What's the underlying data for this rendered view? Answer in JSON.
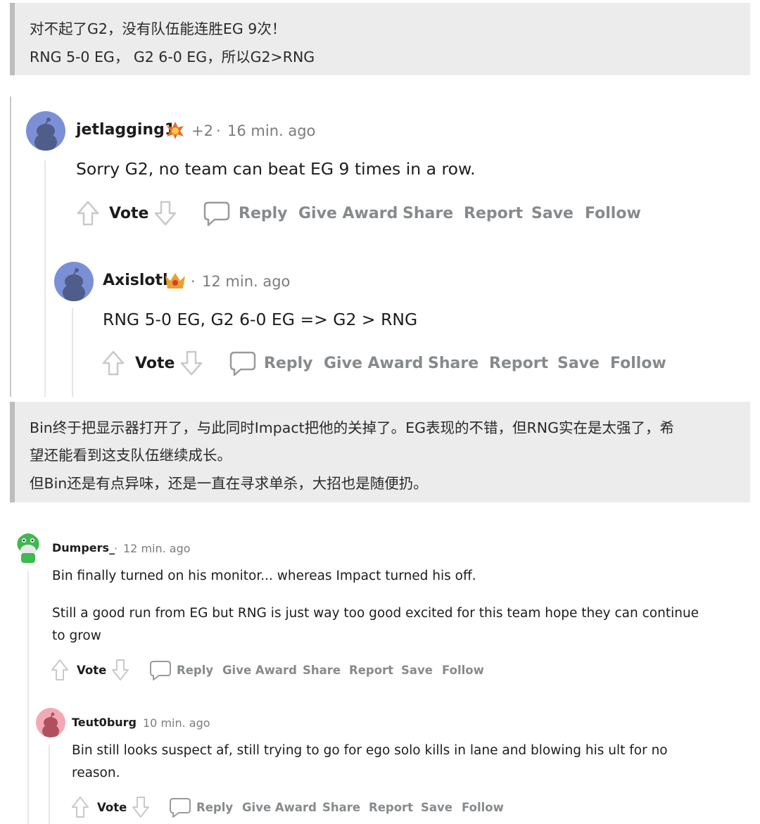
{
  "caption1": {
    "line1": "对不起了G2，没有队伍能连胜EG 9次！",
    "line2": "RNG 5-0 EG， G2 6-0 EG，所以G2>RNG"
  },
  "caption2": {
    "line1": "Bin终于把显示器打开了，与此同时Impact把他的关掉了。EG表现的不错，但RNG实在是太强了，希",
    "line2": "望还能看到这支队伍继续成长。",
    "line3": "但Bin还是有点异味，还是一直在寻求单杀，大招也是随便扔。"
  },
  "comments": [
    {
      "username": "jetlagging1",
      "score": "+2",
      "time": "16 min. ago",
      "body": "Sorry G2, no team can beat EG 9 times in a row.",
      "avatar_color": "#7b8fd6",
      "flair_icon": "award-icon"
    },
    {
      "username": "Axislotl",
      "time": "12 min. ago",
      "body": "RNG 5-0 EG, G2 6-0 EG => G2 > RNG",
      "avatar_color": "#7b8fd6",
      "flair_icon": "crown-award-icon"
    },
    {
      "username": "Dumpers_",
      "time": "12 min. ago",
      "body1": "Bin finally turned on his monitor... whereas Impact turned his off.",
      "body2a": "Still a good run from EG but RNG is just way too good excited for this team hope they can continue",
      "body2b": "to grow",
      "avatar_color": "#3fb950"
    },
    {
      "username": "Teut0burg",
      "time": "10 min. ago",
      "body1": "Bin still looks suspect af, still trying to go for ego solo kills in lane and blowing his ult for no",
      "body2": "reason.",
      "avatar_color": "#e07a8a"
    }
  ],
  "actions": {
    "vote": "Vote",
    "reply": "Reply",
    "give_award": "Give Award",
    "share": "Share",
    "report": "Report",
    "save": "Save",
    "follow": "Follow"
  },
  "separator": "·"
}
